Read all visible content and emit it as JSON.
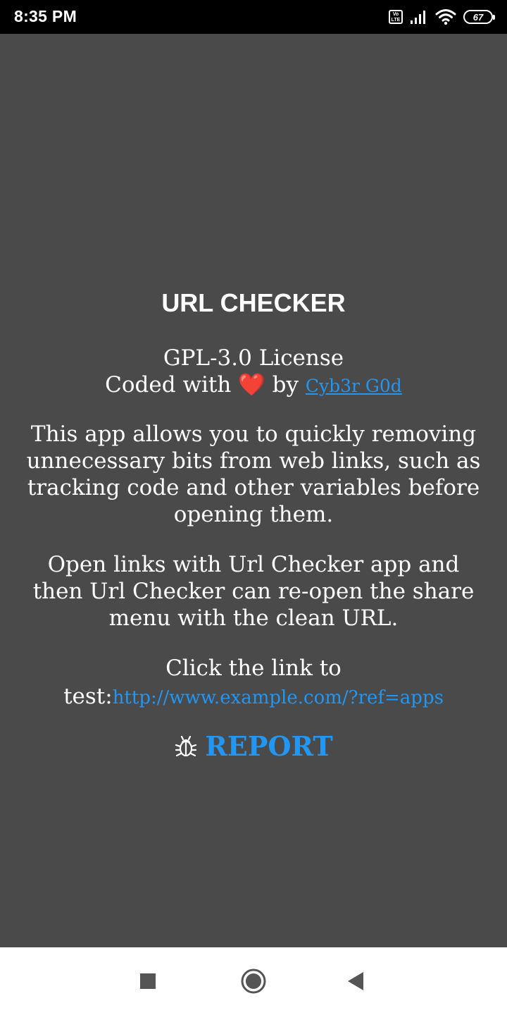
{
  "status_bar": {
    "time": "8:35 PM",
    "volte_label": "Vo LTE",
    "battery_level": "67"
  },
  "about": {
    "app_title": "URL CHECKER",
    "license": "GPL-3.0 License",
    "coded_prefix": "Coded with",
    "heart": "❤️",
    "coded_by": "by",
    "author": "Cyb3r G0d",
    "description": "This app allows you to quickly removing unnecessary bits from web links, such as tracking code and other variables before opening them.",
    "usage": "Open links with Url Checker app and then Url Checker can re-open the share menu with the clean URL.",
    "test_prompt": "Click the link to test:",
    "test_link": "http://www.example.com/?ref=apps",
    "report_label": "REPORT"
  },
  "colors": {
    "background": "#4a4a4a",
    "link": "#2196f3",
    "heart": "#e53935"
  },
  "icons": {
    "report": "bug-icon",
    "nav_recents": "square-icon",
    "nav_home": "circle-icon",
    "nav_back": "triangle-back-icon"
  }
}
